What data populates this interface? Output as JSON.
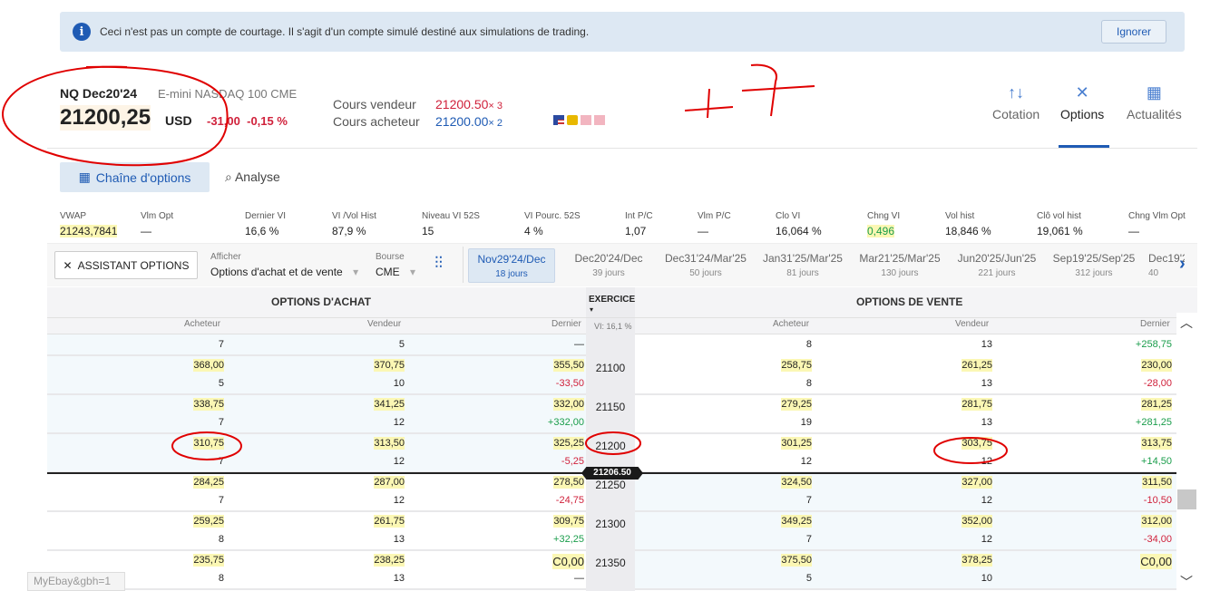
{
  "banner": {
    "message": "Ceci n'est pas un compte de courtage. Il s'agit d'un compte simulé destiné aux simulations de trading.",
    "ignore": "Ignorer"
  },
  "instrument": {
    "symbol": "NQ Dec20'24",
    "description": "E-mini NASDAQ 100  CME",
    "price": "21200,25",
    "currency": "USD",
    "change": "-31,00",
    "change_pct": "-0,15 %"
  },
  "quotes": {
    "ask_label": "Cours vendeur",
    "ask": "21200.50",
    "ask_size": "× 3",
    "bid_label": "Cours acheteur",
    "bid": "21200.00",
    "bid_size": "× 2"
  },
  "nav": [
    {
      "label": "Cotation",
      "icon": "arrows-updown-icon"
    },
    {
      "label": "Options",
      "icon": "options-cross-icon",
      "active": true
    },
    {
      "label": "Actualités",
      "icon": "news-icon"
    }
  ],
  "tabs": {
    "chain": "Chaîne d'options",
    "analysis": "Analyse"
  },
  "stats": [
    {
      "label": "VWAP",
      "value": "21243,7841"
    },
    {
      "label": "Vlm Opt",
      "value": "—"
    },
    {
      "label": "Dernier VI",
      "value": "16,6 %"
    },
    {
      "label": "VI /Vol Hist",
      "value": "87,9 %"
    },
    {
      "label": "Niveau VI 52S",
      "value": "15"
    },
    {
      "label": "VI Pourc. 52S",
      "value": "4 %"
    },
    {
      "label": "Int P/C",
      "value": "1,07"
    },
    {
      "label": "Vlm P/C",
      "value": "—"
    },
    {
      "label": "Clo VI",
      "value": "16,064 %"
    },
    {
      "label": "Chng VI",
      "value": "0,496"
    },
    {
      "label": "Vol hist",
      "value": "18,846 %"
    },
    {
      "label": "Clô vol hist",
      "value": "19,061 %"
    },
    {
      "label": "Chng Vlm Opt",
      "value": "—"
    }
  ],
  "toolbar": {
    "assistant": "ASSISTANT OPTIONS",
    "show_label": "Afficher",
    "show_value": "Options d'achat et de vente",
    "exchange_label": "Bourse",
    "exchange_value": "CME"
  },
  "expirations": [
    {
      "label": "Nov29'24/Dec",
      "days": "18 jours",
      "active": true
    },
    {
      "label": "Dec20'24/Dec",
      "days": "39 jours"
    },
    {
      "label": "Dec31'24/Mar'25",
      "days": "50 jours"
    },
    {
      "label": "Jan31'25/Mar'25",
      "days": "81 jours"
    },
    {
      "label": "Mar21'25/Mar'25",
      "days": "130 jours"
    },
    {
      "label": "Jun20'25/Jun'25",
      "days": "221 jours"
    },
    {
      "label": "Sep19'25/Sep'25",
      "days": "312 jours"
    },
    {
      "label": "Dec19'2",
      "days": "40"
    }
  ],
  "table": {
    "calls_title": "OPTIONS D'ACHAT",
    "puts_title": "OPTIONS DE VENTE",
    "strike_title": "EXERCICE",
    "iv": "VI: 16,1 %",
    "cols": [
      "Acheteur",
      "Vendeur",
      "Dernier"
    ],
    "current_price": "21206.50",
    "partial": {
      "call": [
        "7",
        "5",
        "—"
      ],
      "put": [
        "8",
        "13",
        "+258,75"
      ]
    },
    "rows": [
      {
        "strike": "21100",
        "call": {
          "bid": "368,00",
          "ask": "370,75",
          "last": "355,50",
          "bid_sz": "5",
          "ask_sz": "10",
          "chg": "-33,50"
        },
        "put": {
          "bid": "258,75",
          "ask": "261,25",
          "last": "230,00",
          "bid_sz": "8",
          "ask_sz": "13",
          "chg": "-28,00"
        }
      },
      {
        "strike": "21150",
        "call": {
          "bid": "338,75",
          "ask": "341,25",
          "last": "332,00",
          "bid_sz": "7",
          "ask_sz": "12",
          "chg": "+332,00"
        },
        "put": {
          "bid": "279,25",
          "ask": "281,75",
          "last": "281,25",
          "bid_sz": "19",
          "ask_sz": "13",
          "chg": "+281,25"
        }
      },
      {
        "strike": "21200",
        "call": {
          "bid": "310,75",
          "ask": "313,50",
          "last": "325,25",
          "bid_sz": "7",
          "ask_sz": "12",
          "chg": "-5,25"
        },
        "put": {
          "bid": "301,25",
          "ask": "303,75",
          "last": "313,75",
          "bid_sz": "12",
          "ask_sz": "12",
          "chg": "+14,50"
        }
      },
      {
        "strike": "21250",
        "call": {
          "bid": "284,25",
          "ask": "287,00",
          "last": "278,50",
          "bid_sz": "7",
          "ask_sz": "12",
          "chg": "-24,75"
        },
        "put": {
          "bid": "324,50",
          "ask": "327,00",
          "last": "311,50",
          "bid_sz": "7",
          "ask_sz": "12",
          "chg": "-10,50"
        }
      },
      {
        "strike": "21300",
        "call": {
          "bid": "259,25",
          "ask": "261,75",
          "last": "309,75",
          "bid_sz": "8",
          "ask_sz": "13",
          "chg": "+32,25"
        },
        "put": {
          "bid": "349,25",
          "ask": "352,00",
          "last": "312,00",
          "bid_sz": "7",
          "ask_sz": "12",
          "chg": "-34,00"
        }
      },
      {
        "strike": "21350",
        "call": {
          "bid": "235,75",
          "ask": "238,25",
          "last": "C0,00",
          "bid_sz": "8",
          "ask_sz": "13",
          "chg": "—"
        },
        "put": {
          "bid": "375,50",
          "ask": "378,25",
          "last": "C0,00",
          "bid_sz": "5",
          "ask_sz": "10",
          "chg": ""
        }
      }
    ]
  },
  "tooltip": "MyEbay&gbh=1",
  "colors": {
    "accent": "#1f5bb4",
    "negative": "#d0213b",
    "positive": "#1a9d4b",
    "highlight": "#fbf7b4",
    "annotation": "#e00000"
  }
}
